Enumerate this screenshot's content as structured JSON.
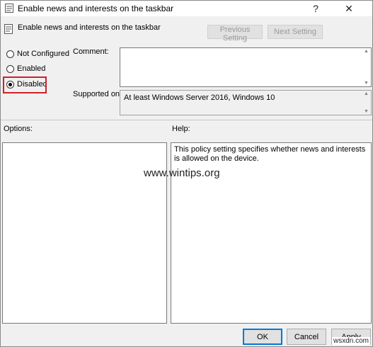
{
  "window": {
    "title": "Enable news and interests on the taskbar",
    "help_glyph": "?",
    "close_glyph": "✕"
  },
  "header": {
    "policy_name": "Enable news and interests on the taskbar",
    "prev_label": "Previous Setting",
    "next_label": "Next Setting"
  },
  "state": {
    "options": [
      {
        "label": "Not Configured",
        "checked": false
      },
      {
        "label": "Enabled",
        "checked": false
      },
      {
        "label": "Disabled",
        "checked": true
      }
    ],
    "highlight_color": "#d0202a"
  },
  "comment": {
    "label": "Comment:",
    "value": ""
  },
  "supported": {
    "label": "Supported on:",
    "value": "At least Windows Server 2016, Windows 10"
  },
  "options_section": {
    "label": "Options:"
  },
  "help_section": {
    "label": "Help:",
    "text": "This policy setting specifies whether news and interests is allowed on the device."
  },
  "watermark": "www.wintips.org",
  "footer": {
    "ok_label": "OK",
    "cancel_label": "Cancel",
    "apply_label": "Apply"
  },
  "corner_mark": "wsxdn.com",
  "colors": {
    "ok_border": "#0078d7",
    "disabled_text": "#9a9a9a"
  }
}
